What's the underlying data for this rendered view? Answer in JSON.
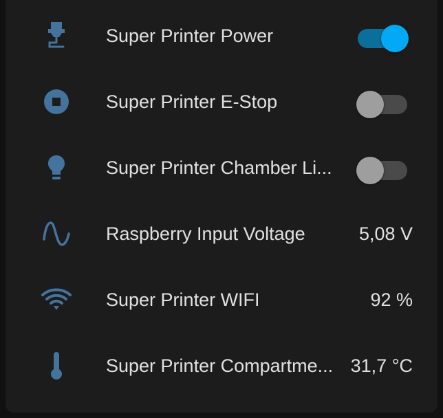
{
  "colors": {
    "icon": "#44739e",
    "toggle_on_knob": "#03a9f4",
    "toggle_on_track": "#0a6f9a",
    "toggle_off_knob": "#9e9e9e",
    "toggle_off_track": "#4a4a4a",
    "card_background": "#1c1c1c",
    "text": "#e1e1e1"
  },
  "entities": [
    {
      "icon": "printer-3d-nozzle-icon",
      "name": "Super Printer Power",
      "control": "toggle",
      "state": "on"
    },
    {
      "icon": "stop-circle-icon",
      "name": "Super Printer E-Stop",
      "control": "toggle",
      "state": "off"
    },
    {
      "icon": "lightbulb-icon",
      "name": "Super Printer Chamber Li...",
      "control": "toggle",
      "state": "off"
    },
    {
      "icon": "sine-wave-icon",
      "name": "Raspberry Input Voltage",
      "control": "value",
      "value": "5,08 V"
    },
    {
      "icon": "wifi-icon",
      "name": "Super Printer WIFI",
      "control": "value",
      "value": "92 %"
    },
    {
      "icon": "thermometer-icon",
      "name": "Super Printer Compartme...",
      "control": "value",
      "value": "31,7 °C"
    }
  ]
}
